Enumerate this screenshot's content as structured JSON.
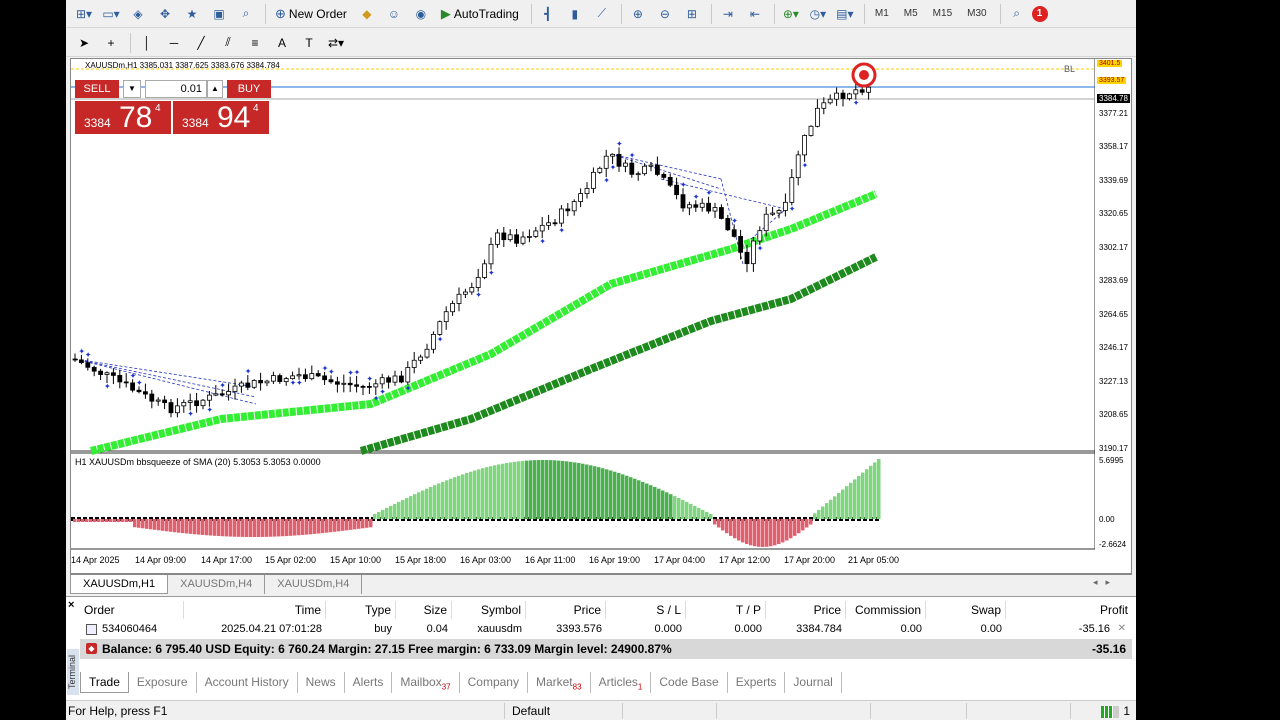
{
  "toolbar1": {
    "new_order_label": "New Order",
    "autotrading_label": "AutoTrading",
    "timeframes": [
      "M1",
      "M5",
      "M15",
      "M30"
    ],
    "notification_count": "1"
  },
  "chart": {
    "header": "XAUUSDm,H1  3385.031 3387.625 3383.676 3384.784",
    "bl_label": "BL",
    "trade_panel": {
      "sell_label": "SELL",
      "buy_label": "BUY",
      "lot": "0.01",
      "sell_price_small": "3384",
      "sell_price_big": "78",
      "sell_price_sup": "4",
      "buy_price_small": "3384",
      "buy_price_big": "94",
      "buy_price_sup": "4"
    },
    "price_axis": [
      "3377.21",
      "3358.17",
      "3339.69",
      "3320.65",
      "3302.17",
      "3283.69",
      "3264.65",
      "3246.17",
      "3227.13",
      "3208.65",
      "3190.17"
    ],
    "price_highlight_1": "3401.5",
    "price_highlight_2": "3393.57",
    "current_price": "3384.78",
    "indicator_label": "H1 XAUUSDm bbsqueeze of SMA (20) 5.3053 5.3053 0.0000",
    "indicator_axis": [
      "5.6995",
      "0.00",
      "-2.6624"
    ],
    "time_axis": [
      "14 Apr 2025",
      "14 Apr 09:00",
      "14 Apr 17:00",
      "15 Apr 02:00",
      "15 Apr 10:00",
      "15 Apr 18:00",
      "16 Apr 03:00",
      "16 Apr 11:00",
      "16 Apr 19:00",
      "17 Apr 04:00",
      "17 Apr 12:00",
      "17 Apr 20:00",
      "21 Apr 05:00"
    ],
    "colors": {
      "bull_candle": "#ffffff",
      "bear_candle": "#000000",
      "fast_ma": "#33ee33",
      "slow_ma": "#1e8a1e",
      "histogram_pos": "#4caf50",
      "histogram_neg": "#e06070",
      "signal_marker": "#1a33cc"
    }
  },
  "chart_tabs": [
    "XAUUSDm,H1",
    "XAUUSDm,H4",
    "XAUUSDm,H4"
  ],
  "terminal": {
    "side_label": "Terminal",
    "columns": [
      "Order",
      "Time",
      "Type",
      "Size",
      "Symbol",
      "Price",
      "S / L",
      "T / P",
      "Price",
      "Commission",
      "Swap",
      "Profit"
    ],
    "order_row": {
      "order": "534060464",
      "time": "2025.04.21 07:01:28",
      "type": "buy",
      "size": "0.04",
      "symbol": "xauusdm",
      "open_price": "3393.576",
      "sl": "0.000",
      "tp": "0.000",
      "current_price": "3384.784",
      "commission": "0.00",
      "swap": "0.00",
      "profit": "-35.16"
    },
    "balance_text": "Balance: 6 795.40 USD  Equity: 6 760.24  Margin: 27.15  Free margin: 6 733.09  Margin level: 24900.87%",
    "balance_profit": "-35.16",
    "tabs": [
      {
        "label": "Trade",
        "count": ""
      },
      {
        "label": "Exposure",
        "count": ""
      },
      {
        "label": "Account History",
        "count": ""
      },
      {
        "label": "News",
        "count": ""
      },
      {
        "label": "Alerts",
        "count": ""
      },
      {
        "label": "Mailbox",
        "count": "37"
      },
      {
        "label": "Company",
        "count": ""
      },
      {
        "label": "Market",
        "count": "83"
      },
      {
        "label": "Articles",
        "count": "1"
      },
      {
        "label": "Code Base",
        "count": ""
      },
      {
        "label": "Experts",
        "count": ""
      },
      {
        "label": "Journal",
        "count": ""
      }
    ]
  },
  "statusbar": {
    "help": "For Help, press F1",
    "profile": "Default",
    "traffic": "1"
  }
}
